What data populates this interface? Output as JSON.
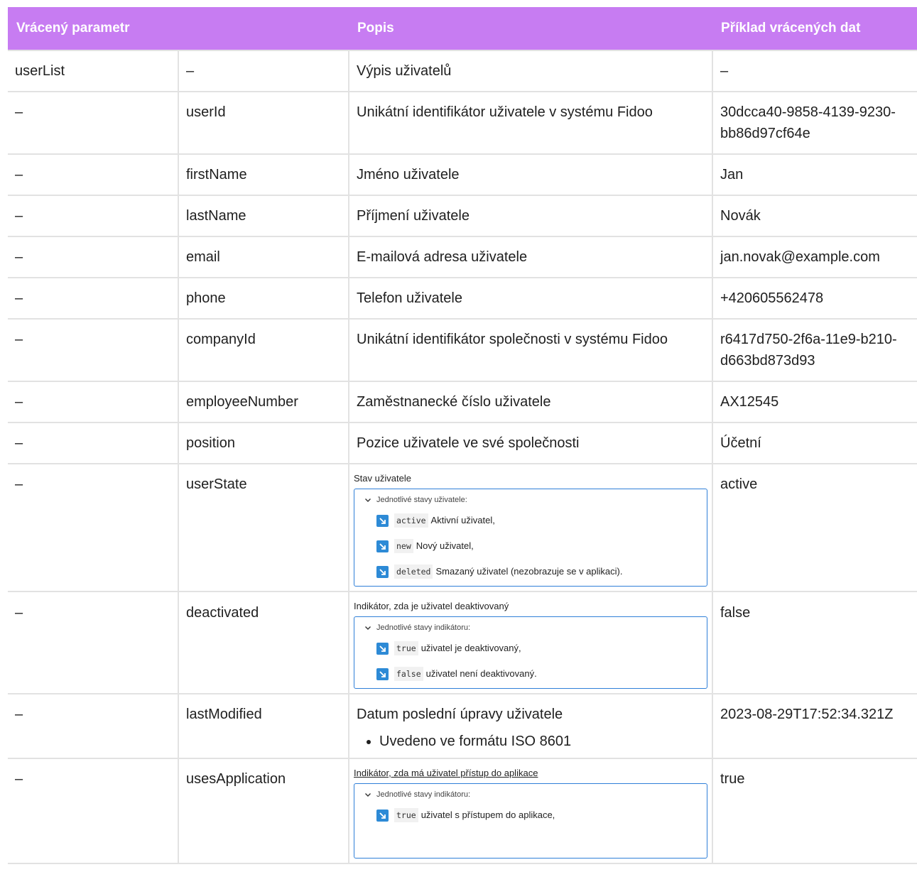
{
  "header": {
    "col1": "Vrácený parametr",
    "col2": "",
    "col3": "Popis",
    "col4": "Příklad vrácených dat"
  },
  "rows": [
    {
      "a": "userList",
      "b": "–",
      "c": "Výpis uživatelů",
      "d": "–"
    },
    {
      "a": "–",
      "b": "userId",
      "c": "Unikátní identifikátor uživatele v systému Fidoo",
      "d": "30dcca40-9858-4139-9230-bb86d97cf64e"
    },
    {
      "a": "–",
      "b": "firstName",
      "c": "Jméno uživatele",
      "d": "Jan"
    },
    {
      "a": "–",
      "b": "lastName",
      "c": "Příjmení uživatele",
      "d": "Novák"
    },
    {
      "a": "–",
      "b": "email",
      "c": "E-mailová adresa uživatele",
      "d": "jan.novak@example.com"
    },
    {
      "a": "–",
      "b": "phone",
      "c": "Telefon uživatele",
      "d": "+420605562478"
    },
    {
      "a": "–",
      "b": "companyId",
      "c": "Unikátní identifikátor společnosti v systému Fidoo",
      "d": "r6417d750-2f6a-11e9-b210-d663bd873d93"
    },
    {
      "a": "–",
      "b": "employeeNumber",
      "c": "Zaměstnanecké číslo uživatele",
      "d": "AX12545"
    },
    {
      "a": "–",
      "b": "position",
      "c": "Pozice uživatele ve své společnosti",
      "d": "Účetní"
    }
  ],
  "userState": {
    "a": "–",
    "b": "userState",
    "d": "active",
    "title": "Stav uživatele",
    "expand_label": "Jednotlivé stavy uživatele:",
    "items": [
      {
        "code": "active",
        "text": "Aktivní uživatel,"
      },
      {
        "code": "new",
        "text": "Nový uživatel,"
      },
      {
        "code": "deleted",
        "text": "Smazaný uživatel (nezobrazuje se v aplikaci)."
      }
    ]
  },
  "deactivated": {
    "a": "–",
    "b": "deactivated",
    "d": "false",
    "title": "Indikátor, zda je uživatel deaktivovaný",
    "expand_label": "Jednotlivé stavy indikátoru:",
    "items": [
      {
        "code": "true",
        "text": "uživatel je deaktivovaný,"
      },
      {
        "code": "false",
        "text": "uživatel není deaktivovaný."
      }
    ]
  },
  "lastModified": {
    "a": "–",
    "b": "lastModified",
    "d": "2023-08-29T17:52:34.321Z",
    "desc": "Datum poslední úpravy uživatele",
    "bullet": "Uvedeno ve formátu ISO 8601"
  },
  "usesApplication": {
    "a": "–",
    "b": "usesApplication",
    "d": "true",
    "title": "Indikátor, zda má uživatel přístup do aplikace",
    "expand_label": "Jednotlivé stavy indikátoru:",
    "items": [
      {
        "code": "true",
        "text": "uživatel s přístupem do aplikace,"
      }
    ]
  },
  "colors": {
    "header_bg": "#c77cf2",
    "border": "#e2e2e2",
    "expand_border": "#2f7fd8",
    "arrow_icon": "#2d8ad6"
  }
}
